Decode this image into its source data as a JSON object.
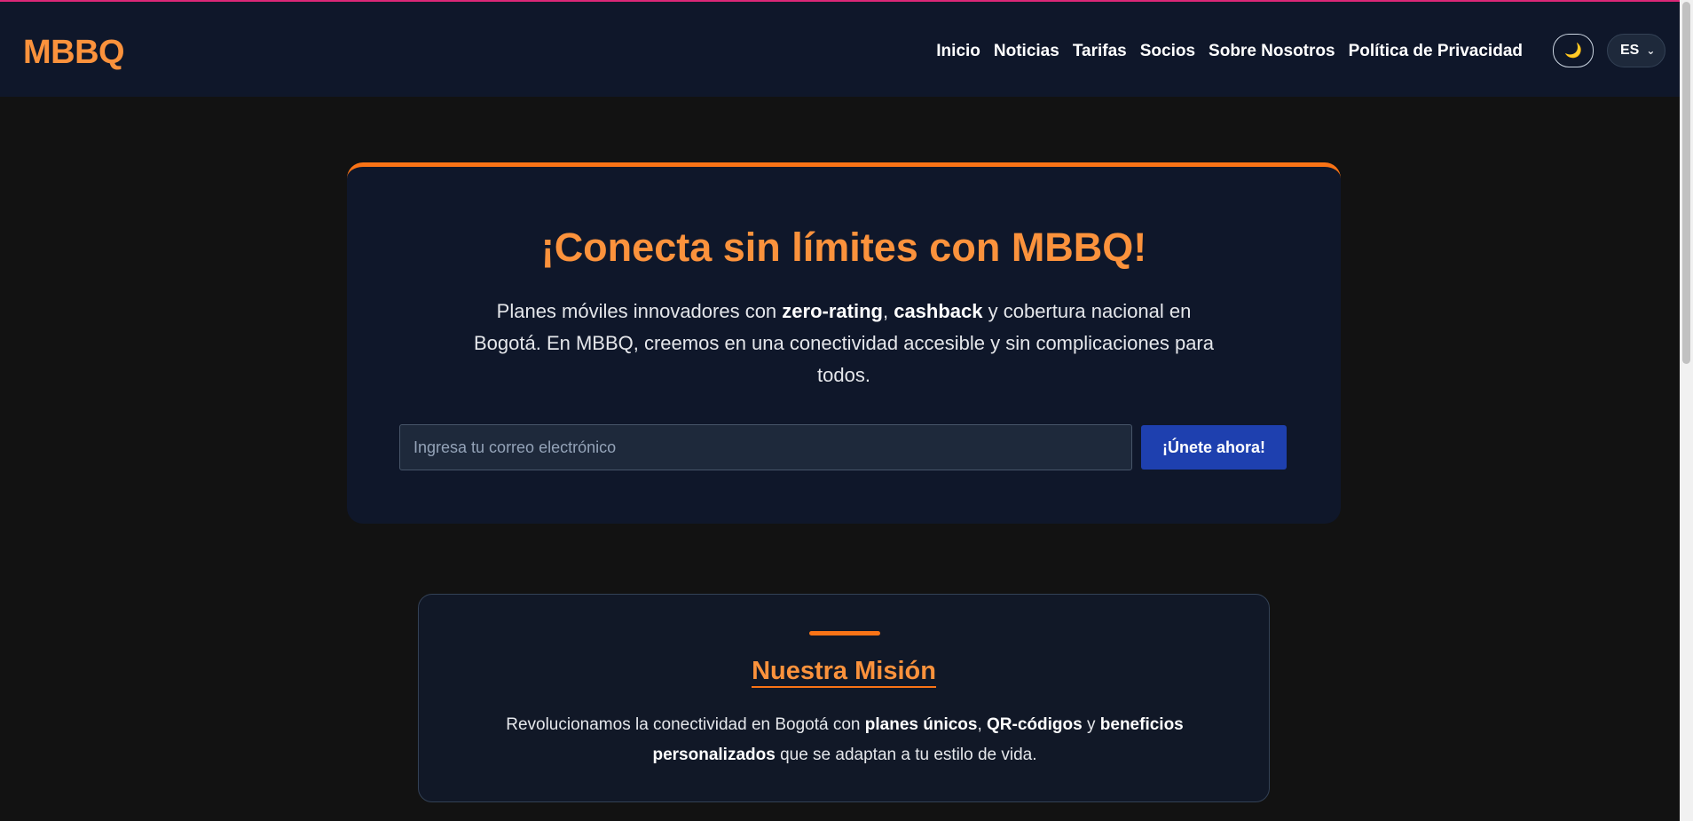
{
  "header": {
    "logo": "MBBQ",
    "nav": [
      "Inicio",
      "Noticias",
      "Tarifas",
      "Socios",
      "Sobre Nosotros",
      "Política de Privacidad"
    ],
    "theme_toggle_icon": "🌙",
    "language": "ES"
  },
  "hero": {
    "title": "¡Conecta sin límites con MBBQ!",
    "desc_part1": "Planes móviles innovadores con ",
    "desc_bold1": "zero-rating",
    "desc_sep": ", ",
    "desc_bold2": "cashback",
    "desc_part2": " y cobertura nacional en Bogotá. En MBBQ, creemos en una conectividad accesible y sin complicaciones para todos.",
    "email_placeholder": "Ingresa tu correo electrónico",
    "email_value": "",
    "join_label": "¡Únete ahora!"
  },
  "mission": {
    "title": "Nuestra Misión",
    "part1": "Revolucionamos la conectividad en Bogotá con ",
    "bold1": "planes únicos",
    "sep1": ", ",
    "bold2": "QR-códigos",
    "sep2": " y ",
    "bold3": "beneficios personalizados",
    "part2": " que se adaptan a tu estilo de vida."
  },
  "colors": {
    "accent": "#f97316",
    "brand_text": "#fb923c",
    "header_bg": "#0f172a",
    "page_bg": "#121212",
    "button_bg": "#1e40af",
    "top_accent": "#db2777"
  }
}
